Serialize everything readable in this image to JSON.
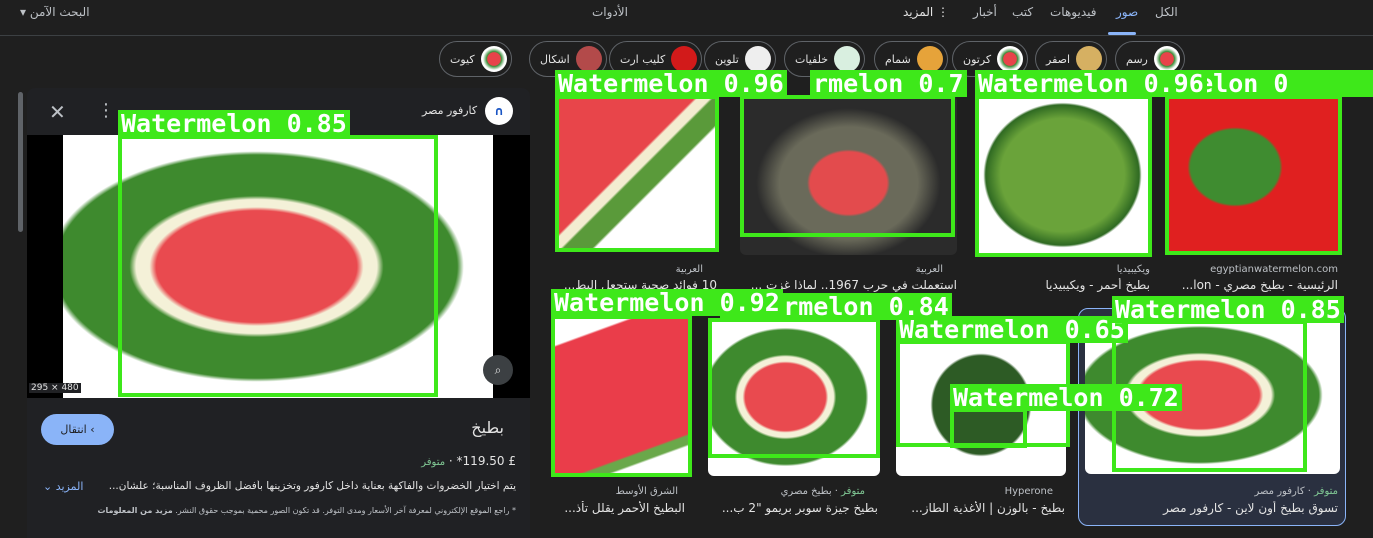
{
  "topbar": {
    "safe_search": "البحث الآمن",
    "tools": "الأدوات",
    "more": "المزيد",
    "tabs": [
      "الكل",
      "صور",
      "فيديوهات",
      "كتب",
      "أخبار"
    ]
  },
  "chips": [
    "رسم",
    "اصفر",
    "كرتون",
    "شمام",
    "خلفيات",
    "تلوين",
    "كليب ارت",
    "اشكال",
    "كيوت"
  ],
  "panel": {
    "source": "كارفور مصر",
    "dimensions": "295 × 480",
    "title": "بطيخ",
    "visit": "انتقال",
    "price": "£ 119.50*",
    "availability": "متوفر",
    "description": "يتم اختيار الخضروات والفاكهة بعناية داخل كارفور وتخزينها بأفضل الظروف المناسبة؛ علشان...",
    "more": "المزيد",
    "disclaimer": "* راجع الموقع الإلكتروني لمعرفة آخر الأسعار ومدى التوفر. قد تكون الصور محمية بموجب حقوق النشر.",
    "learn_more": "مزيد من المعلومات",
    "detection": "Watermelon 0.85"
  },
  "results": [
    {
      "source": "egyptianwatermelon.com",
      "title": "الرئيسية - بطيخ مصري - lon...",
      "detection": "rmelon 0"
    },
    {
      "source": "ويكيبيديا",
      "title": "بطيخ أحمر - ويكيبيديا",
      "detection": "Watermelon 0.96"
    },
    {
      "source": "العربية",
      "title": "استعملت في حرب 1967.. لماذا غزت ...",
      "detection": "rmelon 0.7"
    },
    {
      "source": "العربية",
      "title": "10 فوائد صحية ستجعل البط...",
      "detection": "Watermelon 0.96"
    },
    {
      "source": "كارفور مصر",
      "availability": "متوفر",
      "title": "تسوق بطيخ أون لاين - كارفور مصر",
      "detection": "Watermelon 0.85"
    },
    {
      "source": "Hyperone",
      "title": "بطيخ - بالوزن | الأغذية الطاز...",
      "detection": "Watermelon 0.65",
      "detection2": "Watermelon 0.72"
    },
    {
      "source": "بطيخ مصري",
      "availability": "متوفر",
      "title": "بطيخ جيزة سوبر بريمو \"2 ب...",
      "detection": "Watermelon 0.84"
    },
    {
      "source": "الشرق الأوسط",
      "title": "البطيخ الأحمر يقلل تأذ...",
      "detection": "Watermelon 0.92"
    }
  ]
}
